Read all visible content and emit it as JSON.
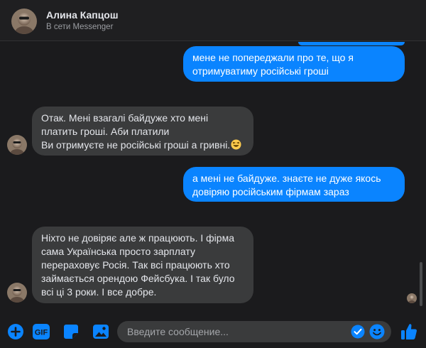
{
  "header": {
    "contact_name": "Алина Капцош",
    "status": "В сети Messenger"
  },
  "messages": [
    {
      "direction": "outgoing",
      "lines": [
        "мене не попереджали про те, що я",
        "отримуватиму російські гроші"
      ]
    },
    {
      "direction": "incoming",
      "lines": [
        "Отак. Мені взагалі байдуже хто мені",
        "платить гроші. Аби платили",
        "Ви отримуєте не російські гроші а гривні."
      ],
      "emoji": "laughing-face"
    },
    {
      "direction": "outgoing",
      "lines": [
        "а мені не байдуже. знаєте не дуже якось",
        "довіряю російським фірмам зараз"
      ]
    },
    {
      "direction": "incoming",
      "lines": [
        "Ніхто не довіряє але ж працюють. І фірма",
        "сама Українська просто зарплату",
        "перераховує Росія. Так всі працюють хто",
        "займається орендою Фейсбука. І так було",
        "всі ці 3 роки. І все добре."
      ]
    }
  ],
  "composer": {
    "placeholder": "Введите сообщение...",
    "icons": [
      "plus-icon",
      "gif-icon",
      "sticker-icon",
      "image-icon",
      "checkmark-icon",
      "emoji-icon",
      "thumbs-up-icon"
    ]
  },
  "colors": {
    "accent": "#0a84ff",
    "incoming_bubble": "#3a3b3c",
    "background": "#1b1b1d"
  }
}
